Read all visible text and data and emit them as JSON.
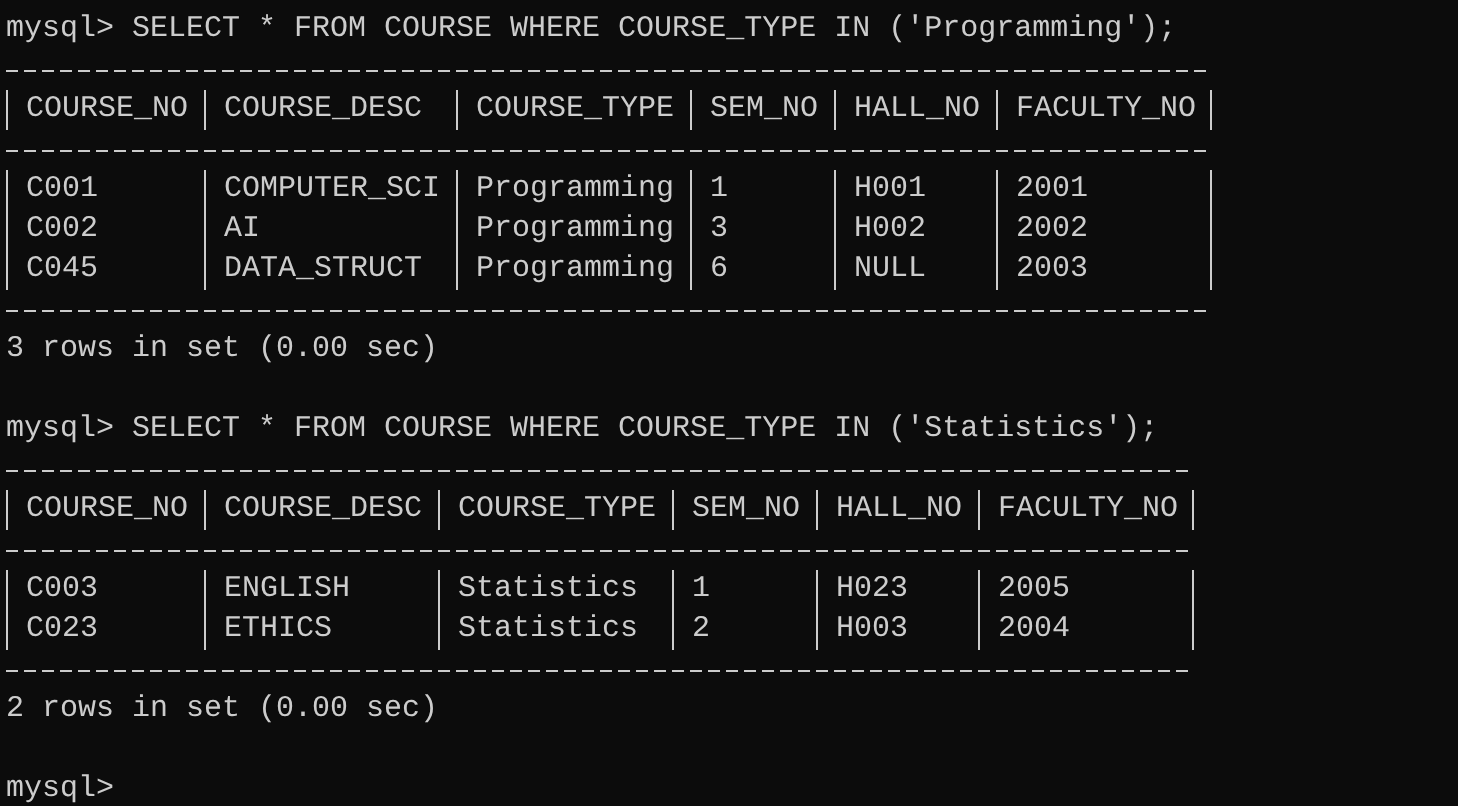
{
  "console": {
    "blocks": [
      {
        "prompt": "mysql>",
        "command": "SELECT * FROM COURSE WHERE COURSE_TYPE IN ('Programming');",
        "columns": [
          "COURSE_NO",
          "COURSE_DESC",
          "COURSE_TYPE",
          "SEM_NO",
          "HALL_NO",
          "FACULTY_NO"
        ],
        "rows": [
          [
            "C001",
            "COMPUTER_SCI",
            "Programming",
            "1",
            "H001",
            "2001"
          ],
          [
            "C002",
            "AI",
            "Programming",
            "3",
            "H002",
            "2002"
          ],
          [
            "C045",
            "DATA_STRUCT",
            "Programming",
            "6",
            "NULL",
            "2003"
          ]
        ],
        "summary": "3 rows in set (0.00 sec)"
      },
      {
        "prompt": "mysql>",
        "command": "SELECT * FROM COURSE WHERE COURSE_TYPE IN ('Statistics');",
        "columns": [
          "COURSE_NO",
          "COURSE_DESC",
          "COURSE_TYPE",
          "SEM_NO",
          "HALL_NO",
          "FACULTY_NO"
        ],
        "rows": [
          [
            "C003",
            "ENGLISH",
            "Statistics",
            "1",
            "H023",
            "2005"
          ],
          [
            "C023",
            "ETHICS",
            "Statistics",
            "2",
            "H003",
            "2004"
          ]
        ],
        "summary": "2 rows in set (0.00 sec)"
      }
    ],
    "final_prompt": "mysql>"
  }
}
